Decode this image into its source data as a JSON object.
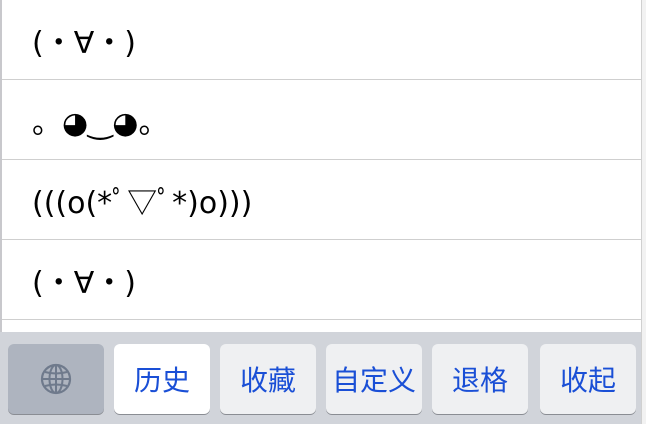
{
  "emoticons": [
    {
      "label": "(・∀・)"
    },
    {
      "label": "。◕‿◕。"
    },
    {
      "label": "(((o(*ﾟ▽ﾟ*)o)))"
    },
    {
      "label": "(・∀・)"
    }
  ],
  "toolbar": {
    "globe_icon": "globe-icon",
    "history_label": "历史",
    "favorites_label": "收藏",
    "custom_label": "自定义",
    "backspace_label": "退格",
    "collapse_label": "收起"
  },
  "colors": {
    "accent": "#1a4fd6",
    "keyboard_bg": "#d1d4da",
    "key_bg": "#eff0f2",
    "active_key_bg": "#ffffff",
    "globe_key_bg": "#aeb4bf"
  }
}
